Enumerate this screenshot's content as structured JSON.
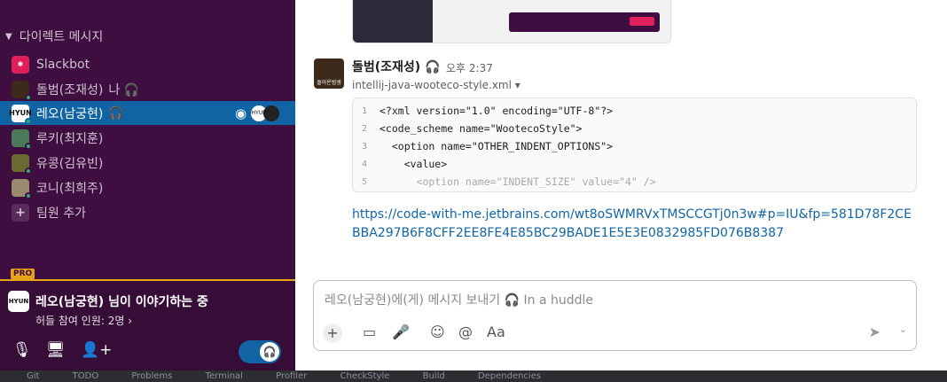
{
  "sidebar": {
    "section_label": "다이렉트 메시지",
    "items": [
      {
        "label": "Slackbot",
        "sub": ""
      },
      {
        "label": "돌범(조재성)",
        "sub": "나 🎧"
      },
      {
        "label": "레오(남궁현)",
        "sub": "🎧"
      },
      {
        "label": "루키(최지훈)",
        "sub": ""
      },
      {
        "label": "유콩(김유빈)",
        "sub": ""
      },
      {
        "label": "코니(최희주)",
        "sub": ""
      },
      {
        "label": "팀원 추가",
        "sub": ""
      }
    ],
    "pro_badge": "PRO",
    "huddle_title": "레오(남궁현) 님이 이야기하는 중",
    "huddle_count": "허들 참여 인원: 2명",
    "huddle_icon_text": "HYUN"
  },
  "message": {
    "author": "돌범(조재성) 🎧",
    "time": "오후 2:37",
    "file_name": "intellij-java-wooteco-style.xml",
    "code_lines": [
      {
        "n": "1",
        "t": "<?xml version=\"1.0\" encoding=\"UTF-8\"?>"
      },
      {
        "n": "2",
        "t": "<code_scheme name=\"WootecoStyle\">"
      },
      {
        "n": "3",
        "t": "  <option name=\"OTHER_INDENT_OPTIONS\">"
      },
      {
        "n": "4",
        "t": "    <value>"
      },
      {
        "n": "5",
        "t": "      <option name=\"INDENT_SIZE\" value=\"4\" />"
      }
    ],
    "link": "https://code-with-me.jetbrains.com/wt8oSWMRVxTMSCCGTj0n3w#p=IU&fp=581D78F2CEBBA297B6F8CFF2EE8FE4E85BC29BADE1E5E3E0832985FD076B8387"
  },
  "composer": {
    "placeholder": "레오(남궁현)에(게) 메시지 보내기 🎧 In a huddle"
  },
  "bottom_tabs": [
    "Git",
    "TODO",
    "Problems",
    "Terminal",
    "Profiler",
    "CheckStyle",
    "Build",
    "Dependencies"
  ],
  "colors": {
    "sidebar": "#3f0e40",
    "active": "#1164a3",
    "accent": "#1264a3",
    "pro": "#e8a317"
  }
}
